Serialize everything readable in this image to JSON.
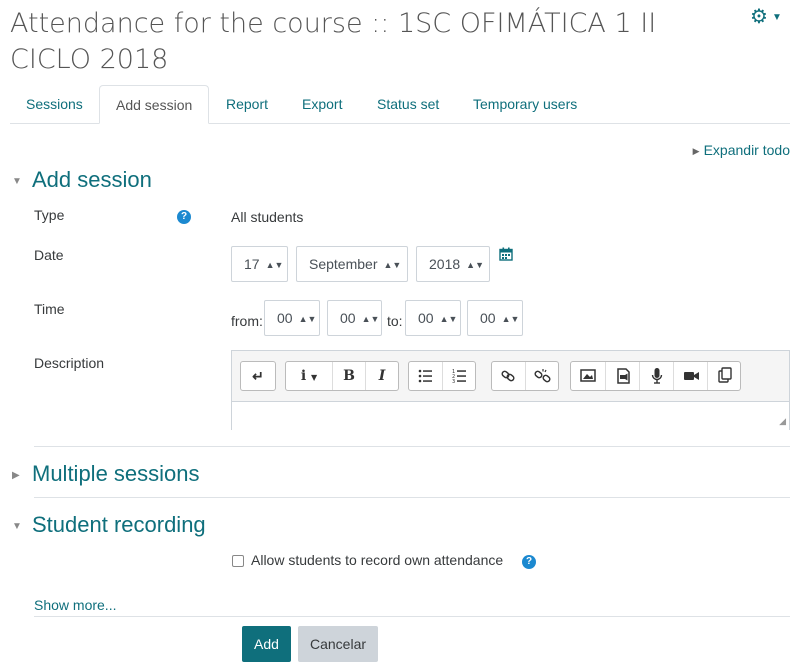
{
  "page": {
    "title": "Attendance for the course :: 1SC OFIMÁTICA 1 II CICLO 2018",
    "settings_icon": "gear-icon"
  },
  "tabs": [
    {
      "label": "Sessions",
      "active": false
    },
    {
      "label": "Add session",
      "active": true
    },
    {
      "label": "Report",
      "active": false
    },
    {
      "label": "Export",
      "active": false
    },
    {
      "label": "Status set",
      "active": false
    },
    {
      "label": "Temporary users",
      "active": false
    }
  ],
  "expand_all": "Expandir todo",
  "add_session": {
    "heading": "Add session",
    "type": {
      "label": "Type",
      "value": "All students"
    },
    "date": {
      "label": "Date",
      "day": "17",
      "month": "September",
      "year": "2018"
    },
    "time": {
      "label": "Time",
      "from_label": "from:",
      "from_hour": "00",
      "from_minute": "00",
      "to_label": "to:",
      "to_hour": "00",
      "to_minute": "00"
    },
    "description": {
      "label": "Description",
      "value": "",
      "toolbar_icons": [
        "collapse-toolbar-icon",
        "paragraph-style-icon",
        "bold-icon",
        "italic-icon",
        "unordered-list-icon",
        "ordered-list-icon",
        "link-icon",
        "unlink-icon",
        "image-icon",
        "media-icon",
        "record-audio-icon",
        "record-video-icon",
        "manage-files-icon"
      ]
    }
  },
  "multiple_sessions": {
    "heading": "Multiple sessions"
  },
  "student_recording": {
    "heading": "Student recording",
    "checkbox_label": "Allow students to record own attendance",
    "checked": false
  },
  "show_more": "Show more...",
  "buttons": {
    "add": "Add",
    "cancel": "Cancelar"
  },
  "colors": {
    "accent": "#0f6f7c",
    "help": "#1c89d0",
    "border": "#ced4da"
  }
}
